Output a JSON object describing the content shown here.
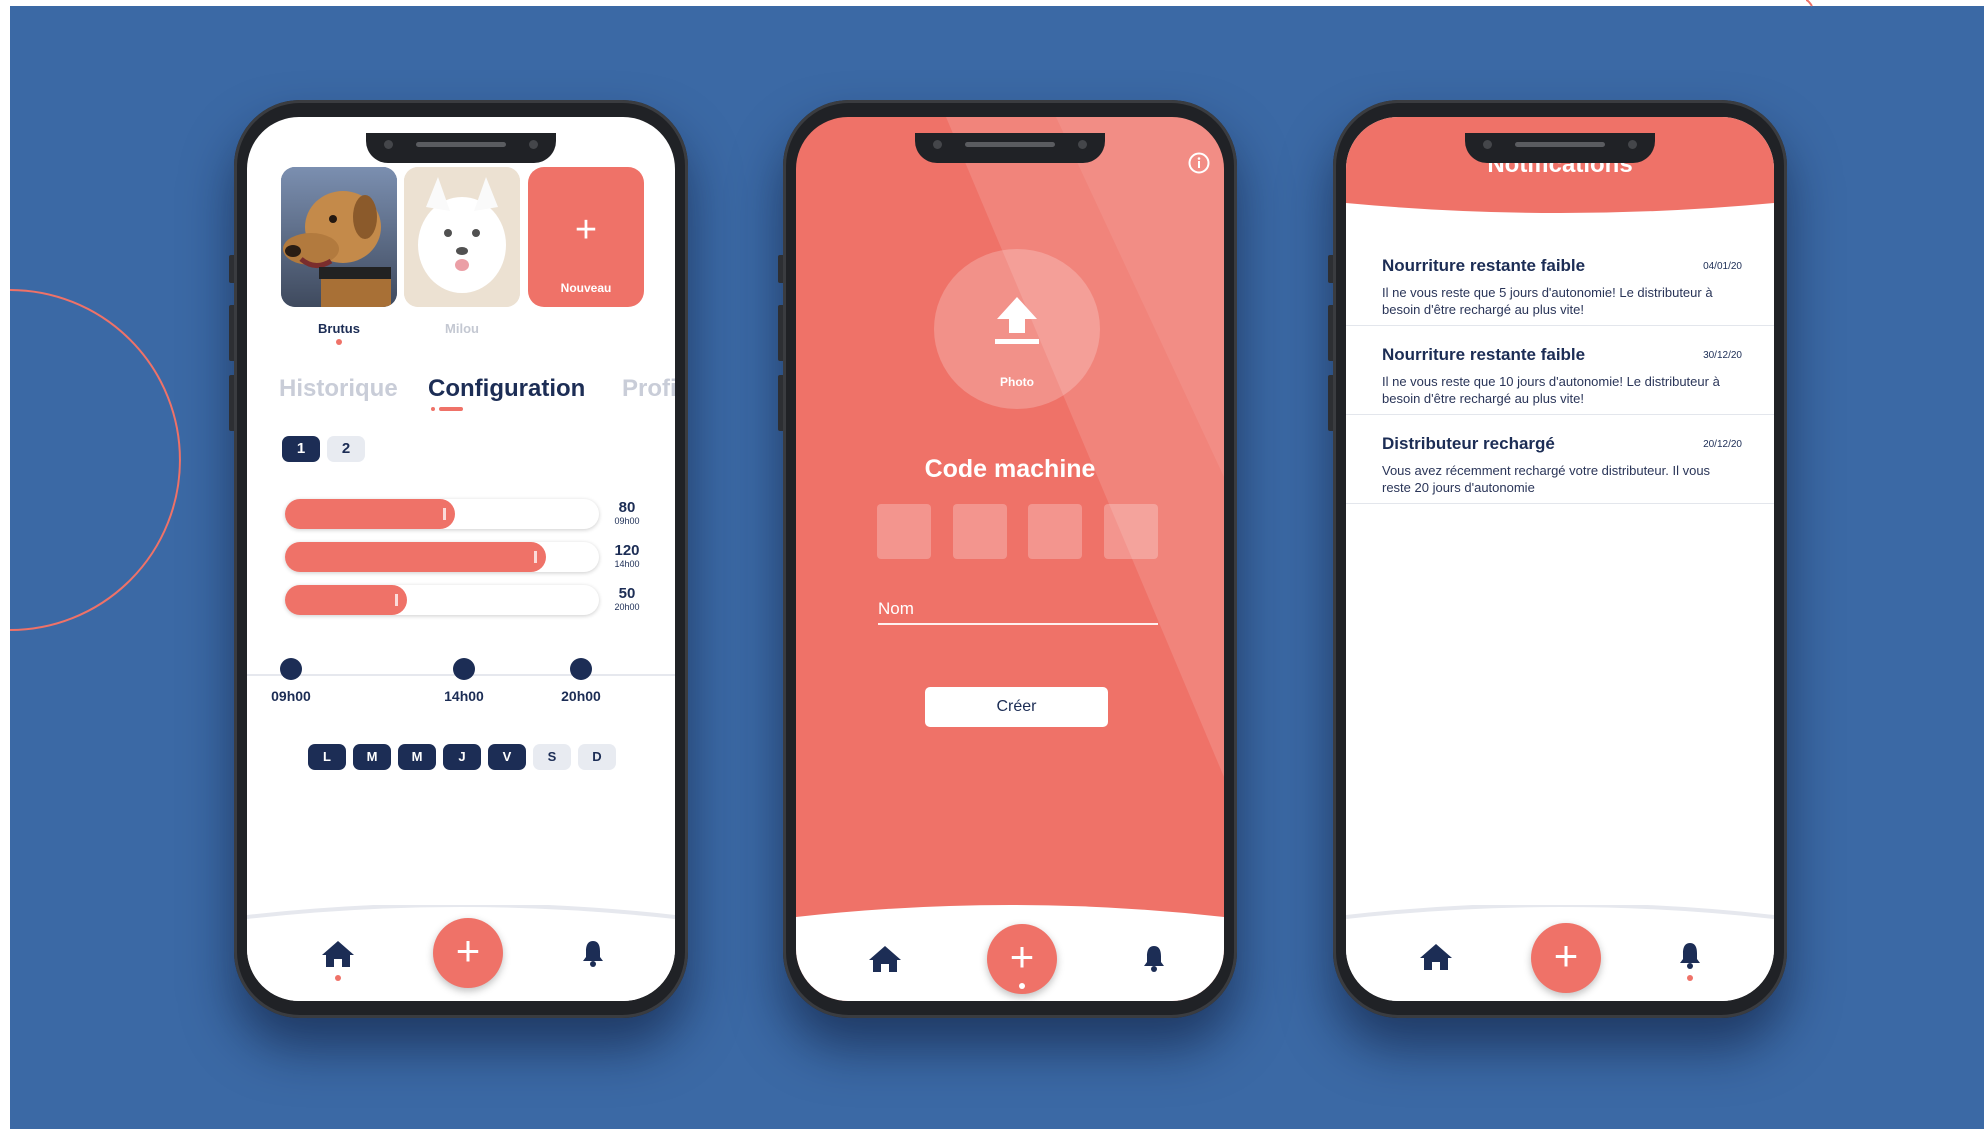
{
  "colors": {
    "background": "#3b69a5",
    "accent": "#ef7268",
    "navy": "#1c2d55"
  },
  "phone1": {
    "pets": [
      {
        "name": "Brutus",
        "selected": true
      },
      {
        "name": "Milou",
        "selected": false
      }
    ],
    "new_card": {
      "plus": "+",
      "label": "Nouveau"
    },
    "tabs": [
      "Historique",
      "Configuration",
      "Profil"
    ],
    "active_tab": "Configuration",
    "pills": [
      "1",
      "2"
    ],
    "feeding_bars": [
      {
        "value": "80",
        "time": "09h00",
        "fill_fraction": 0.54
      },
      {
        "value": "120",
        "time": "14h00",
        "fill_fraction": 0.83
      },
      {
        "value": "50",
        "time": "20h00",
        "fill_fraction": 0.39
      }
    ],
    "timeline": [
      "09h00",
      "14h00",
      "20h00"
    ],
    "days": [
      {
        "label": "L",
        "active": true
      },
      {
        "label": "M",
        "active": true
      },
      {
        "label": "M",
        "active": true
      },
      {
        "label": "J",
        "active": true
      },
      {
        "label": "V",
        "active": true
      },
      {
        "label": "S",
        "active": false
      },
      {
        "label": "D",
        "active": false
      }
    ],
    "nav": {
      "home_icon": "home-icon",
      "fab": "+",
      "bell_icon": "bell-icon"
    }
  },
  "phone2": {
    "info_icon": "info-icon",
    "upload_icon": "upload-icon",
    "photo_label": "Photo",
    "code_title": "Code machine",
    "name_placeholder": "Nom",
    "create_button": "Créer",
    "nav": {
      "fab": "+"
    }
  },
  "phone3": {
    "title": "Notifications",
    "notifications": [
      {
        "title": "Nourriture restante faible",
        "date": "04/01/20",
        "body": "Il ne vous reste que 5 jours d'autonomie! Le distributeur à besoin d'être rechargé au plus vite!"
      },
      {
        "title": "Nourriture restante faible",
        "date": "30/12/20",
        "body": "Il ne vous reste que 10 jours d'autonomie! Le distributeur à besoin d'être rechargé au plus vite!"
      },
      {
        "title": "Distributeur rechargé",
        "date": "20/12/20",
        "body": "Vous avez récemment rechargé votre distributeur. Il vous reste 20 jours d'autonomie"
      }
    ],
    "nav": {
      "fab": "+"
    }
  }
}
